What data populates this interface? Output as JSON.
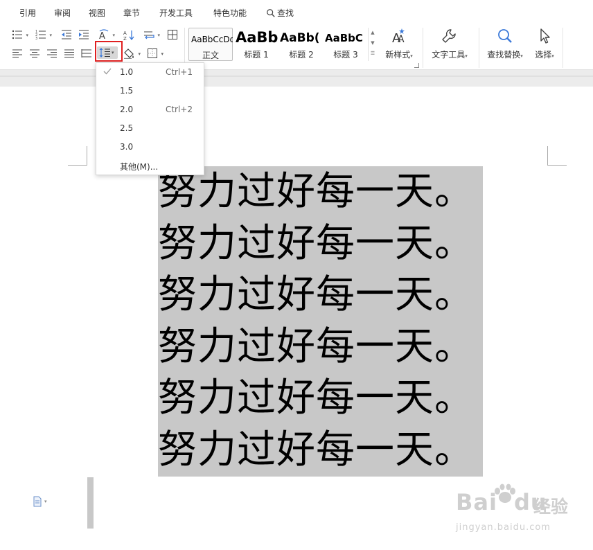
{
  "ribbon": {
    "tabs": [
      "引用",
      "审阅",
      "视图",
      "章节",
      "开发工具",
      "特色功能"
    ],
    "search_label": "查找",
    "styles": [
      {
        "sample": "AaBbCcDd",
        "name": "正文"
      },
      {
        "sample": "AaBb",
        "name": "标题 1"
      },
      {
        "sample": "AaBb(",
        "name": "标题 2"
      },
      {
        "sample": "AaBbC",
        "name": "标题 3"
      }
    ],
    "new_style_label": "新样式",
    "text_tools_label": "文字工具",
    "find_replace_label": "查找替换",
    "select_label": "选择"
  },
  "line_spacing_menu": {
    "items": [
      {
        "label": "1.0",
        "shortcut": "Ctrl+1",
        "checked": true
      },
      {
        "label": "1.5",
        "shortcut": "",
        "checked": false
      },
      {
        "label": "2.0",
        "shortcut": "Ctrl+2",
        "checked": false
      },
      {
        "label": "2.5",
        "shortcut": "",
        "checked": false
      },
      {
        "label": "3.0",
        "shortcut": "",
        "checked": false
      },
      {
        "label": "其他(M)...",
        "shortcut": "",
        "checked": false
      }
    ]
  },
  "document": {
    "lines": [
      "努力过好每一天。",
      "努力过好每一天。",
      "努力过好每一天。",
      "努力过好每一天。",
      "努力过好每一天。",
      "努力过好每一天。"
    ]
  },
  "watermark": {
    "brand": "Bai",
    "brand2": "du",
    "suffix": "经验",
    "url": "jingyan.baidu.com"
  },
  "colors": {
    "highlight_frame": "#e02020",
    "selection": "#c8c8c8"
  }
}
